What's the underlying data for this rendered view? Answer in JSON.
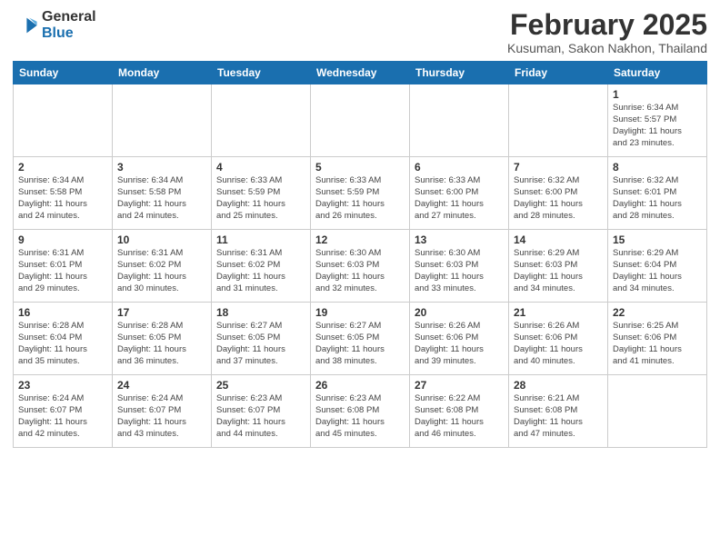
{
  "header": {
    "logo_line1": "General",
    "logo_line2": "Blue",
    "title": "February 2025",
    "subtitle": "Kusuman, Sakon Nakhon, Thailand"
  },
  "weekdays": [
    "Sunday",
    "Monday",
    "Tuesday",
    "Wednesday",
    "Thursday",
    "Friday",
    "Saturday"
  ],
  "weeks": [
    [
      {
        "day": "",
        "info": ""
      },
      {
        "day": "",
        "info": ""
      },
      {
        "day": "",
        "info": ""
      },
      {
        "day": "",
        "info": ""
      },
      {
        "day": "",
        "info": ""
      },
      {
        "day": "",
        "info": ""
      },
      {
        "day": "1",
        "info": "Sunrise: 6:34 AM\nSunset: 5:57 PM\nDaylight: 11 hours\nand 23 minutes."
      }
    ],
    [
      {
        "day": "2",
        "info": "Sunrise: 6:34 AM\nSunset: 5:58 PM\nDaylight: 11 hours\nand 24 minutes."
      },
      {
        "day": "3",
        "info": "Sunrise: 6:34 AM\nSunset: 5:58 PM\nDaylight: 11 hours\nand 24 minutes."
      },
      {
        "day": "4",
        "info": "Sunrise: 6:33 AM\nSunset: 5:59 PM\nDaylight: 11 hours\nand 25 minutes."
      },
      {
        "day": "5",
        "info": "Sunrise: 6:33 AM\nSunset: 5:59 PM\nDaylight: 11 hours\nand 26 minutes."
      },
      {
        "day": "6",
        "info": "Sunrise: 6:33 AM\nSunset: 6:00 PM\nDaylight: 11 hours\nand 27 minutes."
      },
      {
        "day": "7",
        "info": "Sunrise: 6:32 AM\nSunset: 6:00 PM\nDaylight: 11 hours\nand 28 minutes."
      },
      {
        "day": "8",
        "info": "Sunrise: 6:32 AM\nSunset: 6:01 PM\nDaylight: 11 hours\nand 28 minutes."
      }
    ],
    [
      {
        "day": "9",
        "info": "Sunrise: 6:31 AM\nSunset: 6:01 PM\nDaylight: 11 hours\nand 29 minutes."
      },
      {
        "day": "10",
        "info": "Sunrise: 6:31 AM\nSunset: 6:02 PM\nDaylight: 11 hours\nand 30 minutes."
      },
      {
        "day": "11",
        "info": "Sunrise: 6:31 AM\nSunset: 6:02 PM\nDaylight: 11 hours\nand 31 minutes."
      },
      {
        "day": "12",
        "info": "Sunrise: 6:30 AM\nSunset: 6:03 PM\nDaylight: 11 hours\nand 32 minutes."
      },
      {
        "day": "13",
        "info": "Sunrise: 6:30 AM\nSunset: 6:03 PM\nDaylight: 11 hours\nand 33 minutes."
      },
      {
        "day": "14",
        "info": "Sunrise: 6:29 AM\nSunset: 6:03 PM\nDaylight: 11 hours\nand 34 minutes."
      },
      {
        "day": "15",
        "info": "Sunrise: 6:29 AM\nSunset: 6:04 PM\nDaylight: 11 hours\nand 34 minutes."
      }
    ],
    [
      {
        "day": "16",
        "info": "Sunrise: 6:28 AM\nSunset: 6:04 PM\nDaylight: 11 hours\nand 35 minutes."
      },
      {
        "day": "17",
        "info": "Sunrise: 6:28 AM\nSunset: 6:05 PM\nDaylight: 11 hours\nand 36 minutes."
      },
      {
        "day": "18",
        "info": "Sunrise: 6:27 AM\nSunset: 6:05 PM\nDaylight: 11 hours\nand 37 minutes."
      },
      {
        "day": "19",
        "info": "Sunrise: 6:27 AM\nSunset: 6:05 PM\nDaylight: 11 hours\nand 38 minutes."
      },
      {
        "day": "20",
        "info": "Sunrise: 6:26 AM\nSunset: 6:06 PM\nDaylight: 11 hours\nand 39 minutes."
      },
      {
        "day": "21",
        "info": "Sunrise: 6:26 AM\nSunset: 6:06 PM\nDaylight: 11 hours\nand 40 minutes."
      },
      {
        "day": "22",
        "info": "Sunrise: 6:25 AM\nSunset: 6:06 PM\nDaylight: 11 hours\nand 41 minutes."
      }
    ],
    [
      {
        "day": "23",
        "info": "Sunrise: 6:24 AM\nSunset: 6:07 PM\nDaylight: 11 hours\nand 42 minutes."
      },
      {
        "day": "24",
        "info": "Sunrise: 6:24 AM\nSunset: 6:07 PM\nDaylight: 11 hours\nand 43 minutes."
      },
      {
        "day": "25",
        "info": "Sunrise: 6:23 AM\nSunset: 6:07 PM\nDaylight: 11 hours\nand 44 minutes."
      },
      {
        "day": "26",
        "info": "Sunrise: 6:23 AM\nSunset: 6:08 PM\nDaylight: 11 hours\nand 45 minutes."
      },
      {
        "day": "27",
        "info": "Sunrise: 6:22 AM\nSunset: 6:08 PM\nDaylight: 11 hours\nand 46 minutes."
      },
      {
        "day": "28",
        "info": "Sunrise: 6:21 AM\nSunset: 6:08 PM\nDaylight: 11 hours\nand 47 minutes."
      },
      {
        "day": "",
        "info": ""
      }
    ]
  ]
}
